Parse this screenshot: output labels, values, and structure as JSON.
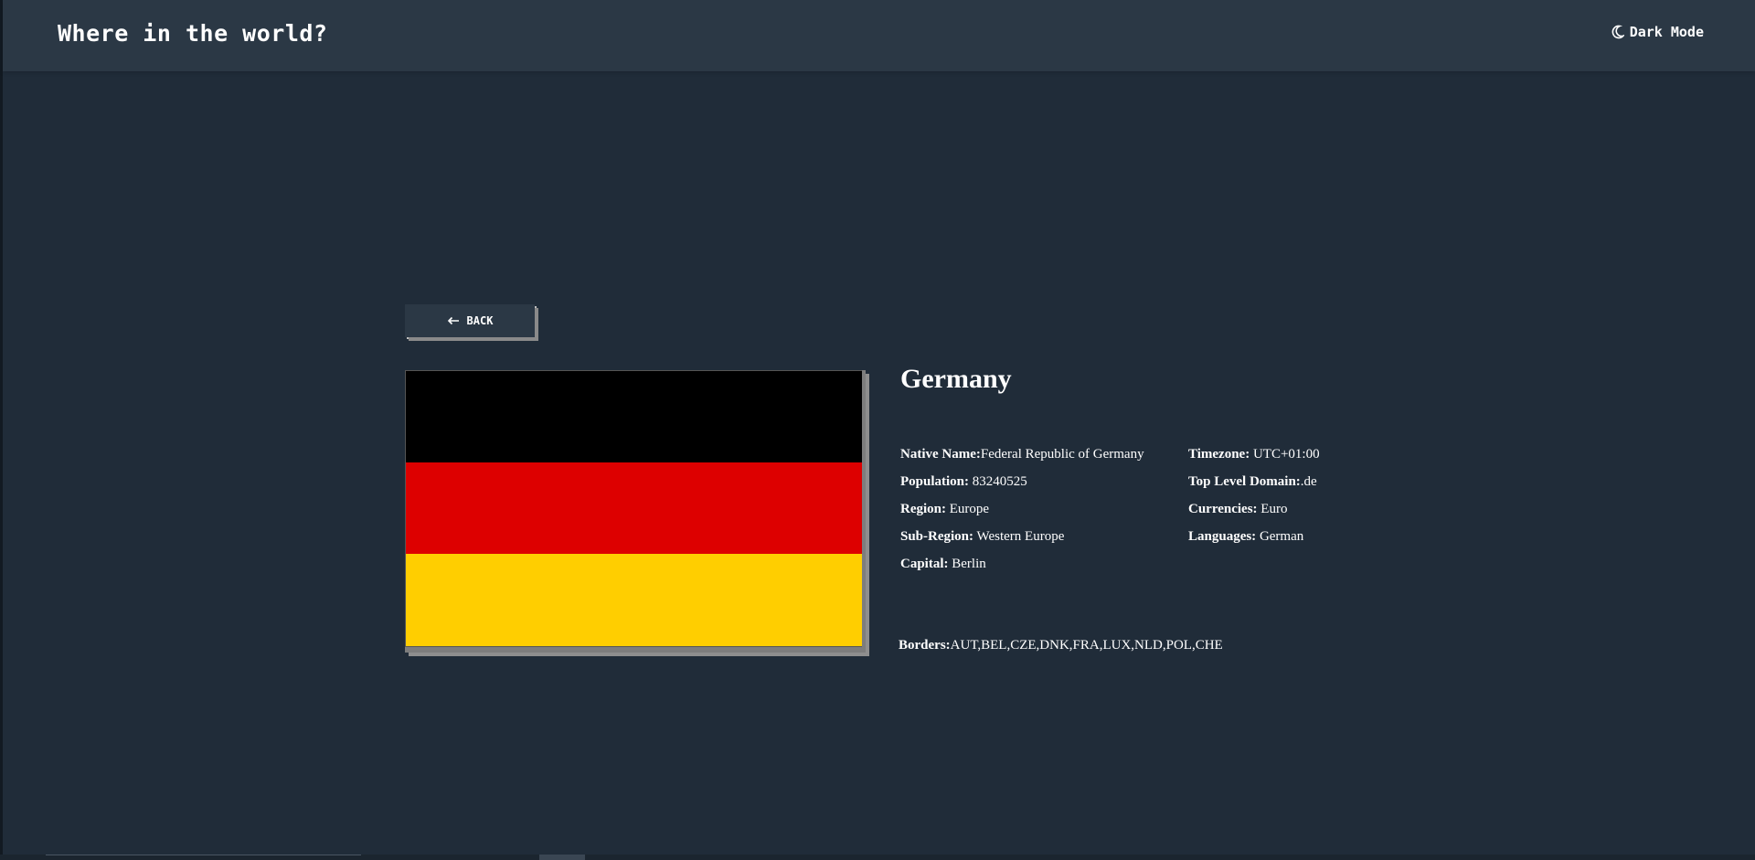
{
  "header": {
    "title": "Where in the world?",
    "dark_mode_label": "Dark Mode",
    "dark_mode_icon": "moon-icon"
  },
  "back": {
    "label": "BACK",
    "icon": "arrow-left-icon"
  },
  "country": {
    "name": "Germany",
    "flag": {
      "description_colors": [
        "#000000",
        "#dd0000",
        "#ffce00"
      ]
    },
    "left_details": [
      {
        "label": "Native Name:",
        "value": "Federal Republic of Germany"
      },
      {
        "label": "Population:",
        "value": " 83240525"
      },
      {
        "label": "Region:",
        "value": " Europe"
      },
      {
        "label": "Sub-Region:",
        "value": " Western Europe"
      },
      {
        "label": "Capital:",
        "value": " Berlin"
      }
    ],
    "right_details": [
      {
        "label": "Timezone:",
        "value": " UTC+01:00"
      },
      {
        "label": "Top Level Domain:",
        "value": ".de"
      },
      {
        "label": "Currencies:",
        "value": " Euro"
      },
      {
        "label": "Languages:",
        "value": " German"
      }
    ],
    "borders_label": "Borders:",
    "borders_value": "AUT,BEL,CZE,DNK,FRA,LUX,NLD,POL,CHE"
  },
  "colors": {
    "background": "#202c39",
    "header": "#2b3845",
    "text": "#ffffff"
  }
}
